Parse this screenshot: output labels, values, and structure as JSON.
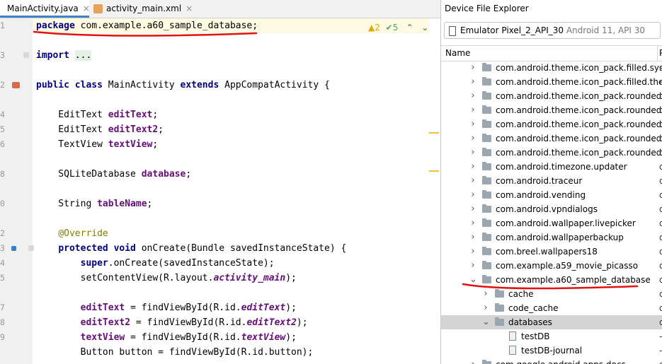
{
  "editor": {
    "tabs": [
      {
        "label": "MainActivity.java",
        "close": "×"
      },
      {
        "label": "activity_main.xml",
        "close": "×"
      }
    ],
    "inspections": {
      "warnings": "▲2",
      "ok": "✔5",
      "up": "⌃",
      "down": "⌄"
    },
    "line_numbers": [
      "1",
      "",
      "3",
      "",
      "2",
      "",
      "4",
      "5",
      "6",
      "",
      "8",
      "",
      "0",
      "",
      "2",
      "3",
      "4",
      "5",
      "",
      "7",
      "8",
      "9",
      ""
    ],
    "lines": [
      [
        {
          "t": "package",
          "c": "kw"
        },
        {
          "t": " com.example.a60_sample_database;",
          "c": ""
        }
      ],
      [],
      [
        {
          "t": "import",
          "c": "kw"
        },
        {
          "t": " ",
          "c": ""
        },
        {
          "t": "...",
          "c": "fold"
        }
      ],
      [],
      [
        {
          "t": "public class",
          "c": "kw"
        },
        {
          "t": " MainActivity ",
          "c": ""
        },
        {
          "t": "extends",
          "c": "kw"
        },
        {
          "t": " AppCompatActivity {",
          "c": ""
        }
      ],
      [],
      [
        {
          "t": "    EditText ",
          "c": ""
        },
        {
          "t": "editText",
          "c": "fld"
        },
        {
          "t": ";",
          "c": ""
        }
      ],
      [
        {
          "t": "    EditText ",
          "c": ""
        },
        {
          "t": "editText2",
          "c": "fld"
        },
        {
          "t": ";",
          "c": ""
        }
      ],
      [
        {
          "t": "    TextView ",
          "c": ""
        },
        {
          "t": "textView",
          "c": "fld"
        },
        {
          "t": ";",
          "c": ""
        }
      ],
      [],
      [
        {
          "t": "    SQLiteDatabase ",
          "c": ""
        },
        {
          "t": "database",
          "c": "fld"
        },
        {
          "t": ";",
          "c": ""
        }
      ],
      [],
      [
        {
          "t": "    String ",
          "c": ""
        },
        {
          "t": "tableName",
          "c": "fld"
        },
        {
          "t": ";",
          "c": ""
        }
      ],
      [],
      [
        {
          "t": "    ",
          "c": ""
        },
        {
          "t": "@Override",
          "c": "ann"
        }
      ],
      [
        {
          "t": "    ",
          "c": ""
        },
        {
          "t": "protected void",
          "c": "kw"
        },
        {
          "t": " onCreate(Bundle savedInstanceState) {",
          "c": ""
        }
      ],
      [
        {
          "t": "        ",
          "c": ""
        },
        {
          "t": "super",
          "c": "kw"
        },
        {
          "t": ".onCreate(savedInstanceState);",
          "c": ""
        }
      ],
      [
        {
          "t": "        setContentView(R.layout.",
          "c": ""
        },
        {
          "t": "activity_main",
          "c": "sfld"
        },
        {
          "t": ");",
          "c": ""
        }
      ],
      [],
      [
        {
          "t": "        ",
          "c": ""
        },
        {
          "t": "editText",
          "c": "fld"
        },
        {
          "t": " = findViewById(R.id.",
          "c": ""
        },
        {
          "t": "editText",
          "c": "sfld"
        },
        {
          "t": ");",
          "c": ""
        }
      ],
      [
        {
          "t": "        ",
          "c": ""
        },
        {
          "t": "editText2",
          "c": "fld"
        },
        {
          "t": " = findViewById(R.id.",
          "c": ""
        },
        {
          "t": "editText2",
          "c": "sfld"
        },
        {
          "t": ");",
          "c": ""
        }
      ],
      [
        {
          "t": "        ",
          "c": ""
        },
        {
          "t": "textView",
          "c": "fld"
        },
        {
          "t": " = findViewById(R.id.",
          "c": ""
        },
        {
          "t": "textView",
          "c": "sfld"
        },
        {
          "t": ");",
          "c": ""
        }
      ],
      [
        {
          "t": "        Button button = findViewById(R.id.button);",
          "c": ""
        }
      ]
    ]
  },
  "file_explorer": {
    "title": "Device File Explorer",
    "device": {
      "name": "Emulator Pixel_2_API_30",
      "detail": "Android 11, API 30"
    },
    "columns": {
      "name": "Name",
      "second": "P"
    },
    "rows": [
      {
        "label": "com.android.theme.icon_pack.filled.systemui",
        "depth": 0,
        "expanded": false,
        "kind": "folder",
        "extra": "d"
      },
      {
        "label": "com.android.theme.icon_pack.filled.themepicker",
        "depth": 0,
        "expanded": false,
        "kind": "folder",
        "extra": "d"
      },
      {
        "label": "com.android.theme.icon_pack.rounded.android",
        "depth": 0,
        "expanded": false,
        "kind": "folder",
        "extra": "d"
      },
      {
        "label": "com.android.theme.icon_pack.rounded.launcher",
        "depth": 0,
        "expanded": false,
        "kind": "folder",
        "extra": "d"
      },
      {
        "label": "com.android.theme.icon_pack.rounded.settings",
        "depth": 0,
        "expanded": false,
        "kind": "folder",
        "extra": "d"
      },
      {
        "label": "com.android.theme.icon_pack.rounded.systemui",
        "depth": 0,
        "expanded": false,
        "kind": "folder",
        "extra": "d"
      },
      {
        "label": "com.android.theme.icon_pack.rounded.themepicker",
        "depth": 0,
        "expanded": false,
        "kind": "folder",
        "extra": "d"
      },
      {
        "label": "com.android.timezone.updater",
        "depth": 0,
        "expanded": false,
        "kind": "folder",
        "extra": "d"
      },
      {
        "label": "com.android.traceur",
        "depth": 0,
        "expanded": false,
        "kind": "folder",
        "extra": "d"
      },
      {
        "label": "com.android.vending",
        "depth": 0,
        "expanded": false,
        "kind": "folder",
        "extra": "d"
      },
      {
        "label": "com.android.vpndialogs",
        "depth": 0,
        "expanded": false,
        "kind": "folder",
        "extra": "d"
      },
      {
        "label": "com.android.wallpaper.livepicker",
        "depth": 0,
        "expanded": false,
        "kind": "folder",
        "extra": "d"
      },
      {
        "label": "com.android.wallpaperbackup",
        "depth": 0,
        "expanded": false,
        "kind": "folder",
        "extra": "d"
      },
      {
        "label": "com.breel.wallpapers18",
        "depth": 0,
        "expanded": false,
        "kind": "folder",
        "extra": "d"
      },
      {
        "label": "com.example.a59_movie_picasso",
        "depth": 0,
        "expanded": false,
        "kind": "folder",
        "extra": "d"
      },
      {
        "label": "com.example.a60_sample_database",
        "depth": 0,
        "expanded": true,
        "kind": "folder",
        "extra": "d"
      },
      {
        "label": "cache",
        "depth": 1,
        "expanded": false,
        "kind": "folder",
        "extra": "d"
      },
      {
        "label": "code_cache",
        "depth": 1,
        "expanded": false,
        "kind": "folder",
        "extra": "d"
      },
      {
        "label": "databases",
        "depth": 1,
        "expanded": true,
        "kind": "folder",
        "extra": "d",
        "selected": true
      },
      {
        "label": "testDB",
        "depth": 2,
        "expanded": false,
        "kind": "file",
        "extra": "-"
      },
      {
        "label": "testDB-journal",
        "depth": 2,
        "expanded": false,
        "kind": "file",
        "extra": "-"
      },
      {
        "label": "com.google.android.apps.docs",
        "depth": 0,
        "expanded": false,
        "kind": "folder",
        "extra": "d"
      }
    ]
  },
  "colors": {
    "keyword": "#000080",
    "field": "#660e7a",
    "annotation": "#808000",
    "underline": "#e21212"
  }
}
